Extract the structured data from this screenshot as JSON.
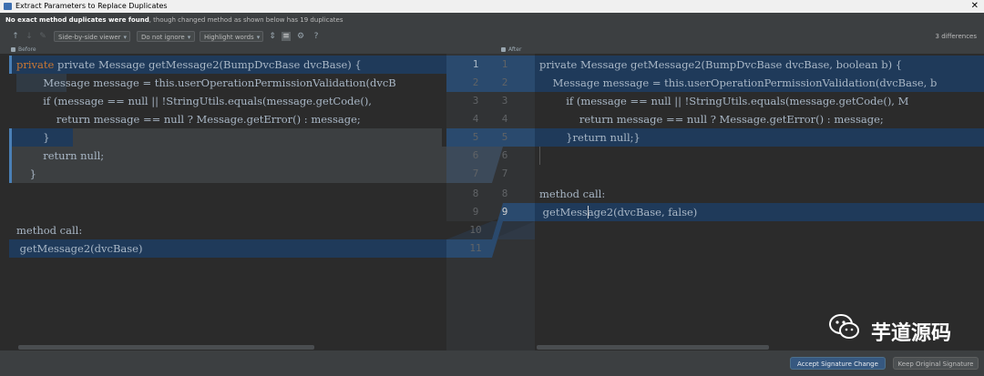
{
  "window": {
    "title": "Extract Parameters to Replace Duplicates",
    "close": "✕"
  },
  "banner": {
    "bold": "No exact method duplicates were found",
    "rest": ", though changed method as shown below has 19 duplicates"
  },
  "toolbar": {
    "viewer": "Side-by-side viewer",
    "ignore": "Do not ignore",
    "highlight": "Highlight words",
    "help": "?",
    "diff_count": "3 differences"
  },
  "panes": {
    "left_header": "Before",
    "right_header": "After"
  },
  "left_code": [
    "private Message getMessage2(BumpDvcBase dvcBase) {",
    "        Message message = this.userOperationPermissionValidation(dvcB",
    "        if (message == null || !StringUtils.equals(message.getCode(),",
    "            return message == null ? Message.getError() : message;",
    "        }",
    "        return null;",
    "    }",
    "",
    "method call:",
    " getMessage2(dvcBase)"
  ],
  "right_code": [
    "private Message getMessage2(BumpDvcBase dvcBase, boolean b) {",
    "    Message message = this.userOperationPermissionValidation(dvcBase, b",
    "        if (message == null || !StringUtils.equals(message.getCode(), M",
    "            return message == null ? Message.getError() : message;",
    "        }return null;}",
    "",
    "",
    "method call:",
    " getMessage2(dvcBase, false)"
  ],
  "left_numbers": [
    "1",
    "2",
    "3",
    "4",
    "5",
    "6",
    "7",
    "8",
    "9",
    "10",
    "11"
  ],
  "right_numbers": [
    "1",
    "2",
    "3",
    "4",
    "5",
    "6",
    "7",
    "8",
    "9"
  ],
  "buttons": {
    "accept": "Accept Signature Change",
    "keep": "Keep Original Signature"
  },
  "watermark": "芋道源码"
}
